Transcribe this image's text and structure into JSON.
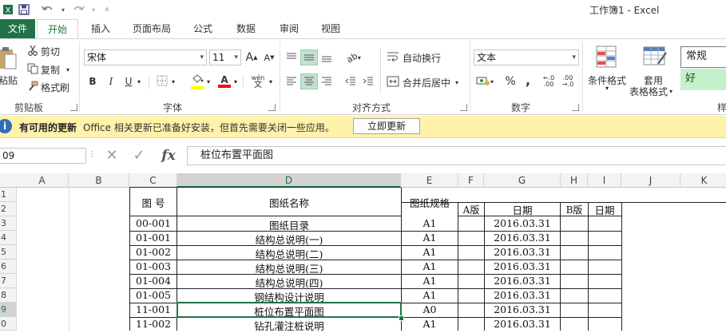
{
  "window": {
    "title": "工作簿1 - Excel"
  },
  "qat": {
    "save": "save-icon",
    "undo": "undo-icon",
    "redo": "redo-icon",
    "customize": "customize-icon"
  },
  "tabs": [
    {
      "label": "文件"
    },
    {
      "label": "开始"
    },
    {
      "label": "插入"
    },
    {
      "label": "页面布局"
    },
    {
      "label": "公式"
    },
    {
      "label": "数据"
    },
    {
      "label": "审阅"
    },
    {
      "label": "视图"
    }
  ],
  "ribbon": {
    "clipboard": {
      "paste": "粘贴",
      "cut": "剪切",
      "copy": "复制",
      "format_painter": "格式刷",
      "label": "剪贴板"
    },
    "font": {
      "name": "宋体",
      "size": "11",
      "grow": "A",
      "shrink": "A",
      "bold": "B",
      "italic": "I",
      "underline": "U",
      "phonetic": "wén",
      "label": "字体",
      "fill_color": "#ffff00",
      "font_color": "#ff0000"
    },
    "alignment": {
      "wrap": "自动换行",
      "merge": "合并后居中",
      "label": "对齐方式"
    },
    "number": {
      "format": "文本",
      "percent": "%",
      "comma": ",",
      "label": "数字"
    },
    "styles": {
      "conditional": "条件格式",
      "table": "套用",
      "table2": "表格格式",
      "normal": "常规",
      "good": "好",
      "label": "样"
    }
  },
  "notification": {
    "icon": "info-icon",
    "title": "有可用的更新",
    "message": "Office 相关更新已准备好安装，但首先需要关闭一些应用。",
    "button": "立即更新"
  },
  "formula_bar": {
    "name_box": "09",
    "cancel": "✕",
    "enter": "✓",
    "fx": "fx",
    "content": "桩位布置平面图"
  },
  "columns": [
    "A",
    "B",
    "C",
    "D",
    "E",
    "F",
    "G",
    "H",
    "I",
    "J",
    "K"
  ],
  "rows": [
    "1",
    "2",
    "3",
    "4",
    "5",
    "6",
    "7",
    "8",
    "9",
    "0"
  ],
  "selected": {
    "column": "D",
    "row": "9"
  },
  "table": {
    "header": {
      "no": "图 号",
      "name": "图纸名称",
      "spec": "图纸规格",
      "a_ver": "A版",
      "date1": "日期",
      "b_ver": "B版",
      "date2": "日期"
    },
    "rows": [
      {
        "no": "00-001",
        "name": "图纸目录",
        "spec": "A1",
        "date": "2016.03.31"
      },
      {
        "no": "01-001",
        "name": "结构总说明(一)",
        "spec": "A1",
        "date": "2016.03.31"
      },
      {
        "no": "01-002",
        "name": "结构总说明(二)",
        "spec": "A1",
        "date": "2016.03.31"
      },
      {
        "no": "01-003",
        "name": "结构总说明(三)",
        "spec": "A1",
        "date": "2016.03.31"
      },
      {
        "no": "01-004",
        "name": "结构总说明(四)",
        "spec": "A1",
        "date": "2016.03.31"
      },
      {
        "no": "01-005",
        "name": "钢结构设计说明",
        "spec": "A1",
        "date": "2016.03.31"
      },
      {
        "no": "11-001",
        "name": "桩位布置平面图",
        "spec": "A0",
        "date": "2016.03.31"
      },
      {
        "no": "11-002",
        "name": "钻孔灌注桩说明",
        "spec": "A1",
        "date": "2016.03.31"
      }
    ]
  },
  "colors": {
    "excel_green": "#217346",
    "notify_bg": "#fff2ab"
  }
}
